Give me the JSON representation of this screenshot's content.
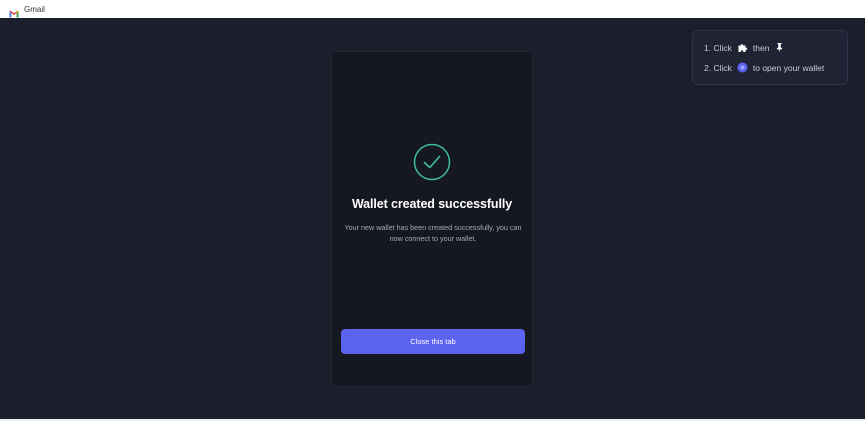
{
  "bookmarks": {
    "items": [
      {
        "label": "Gmail",
        "icon": "gmail-icon"
      }
    ]
  },
  "hint": {
    "line1": {
      "step": "1. Click",
      "icon_a": "puzzle-extension-icon",
      "connector": "then",
      "icon_b": "pin-icon"
    },
    "line2": {
      "step": "2. Click",
      "icon": "wallet-extension-icon",
      "text": "to open your wallet"
    }
  },
  "card": {
    "icon": "check-circle-icon",
    "title": "Wallet created successfully",
    "description": "Your new wallet has been created successfully, you can now connect to your wallet.",
    "button_label": "Close this tab"
  },
  "colors": {
    "background": "#1b1f2b",
    "card": "#151821",
    "accent": "#5b63f0",
    "success": "#3ec0a0"
  }
}
